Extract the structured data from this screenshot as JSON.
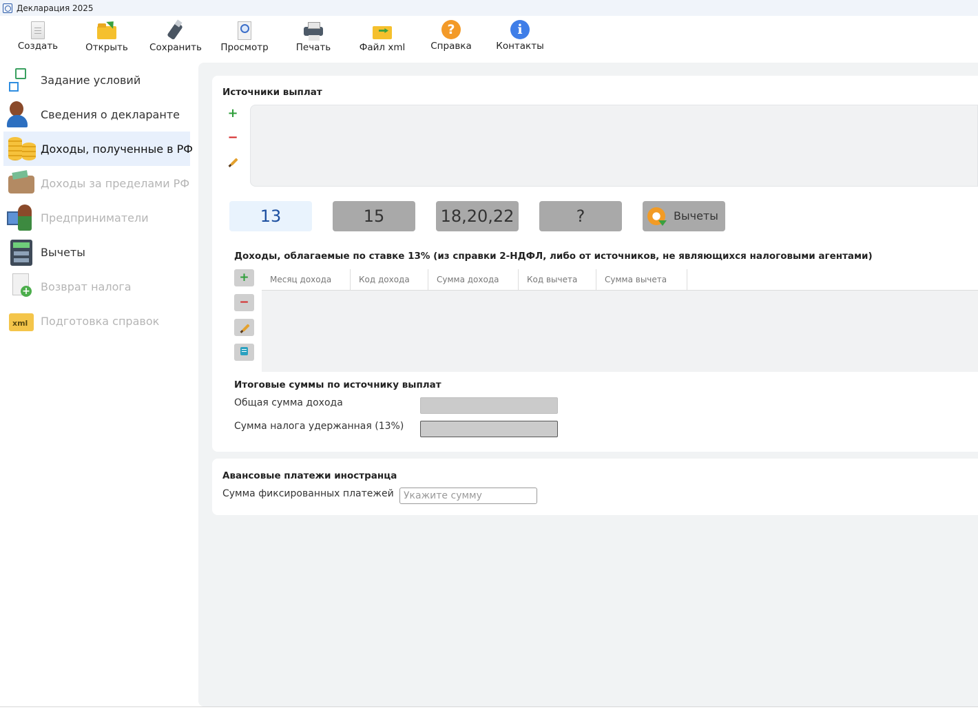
{
  "window": {
    "title": "Декларация 2025"
  },
  "toolbar": {
    "items": [
      {
        "label": "Создать",
        "icon": "new-document-icon"
      },
      {
        "label": "Открыть",
        "icon": "open-folder-icon"
      },
      {
        "label": "Сохранить",
        "icon": "usb-save-icon"
      },
      {
        "label": "Просмотр",
        "icon": "preview-icon"
      },
      {
        "label": "Печать",
        "icon": "printer-icon"
      },
      {
        "label": "Файл xml",
        "icon": "xml-folder-icon"
      },
      {
        "label": "Справка",
        "icon": "help-icon"
      },
      {
        "label": "Контакты",
        "icon": "info-icon"
      }
    ],
    "help_glyph": "?",
    "info_glyph": "i"
  },
  "sidebar": {
    "items": [
      {
        "label": "Задание условий",
        "icon": "conditions-icon",
        "state": "enabled"
      },
      {
        "label": "Сведения о декларанте",
        "icon": "declarant-icon",
        "state": "enabled"
      },
      {
        "label": "Доходы, полученные в РФ",
        "icon": "coins-icon",
        "state": "active"
      },
      {
        "label": "Доходы за пределами РФ",
        "icon": "wallet-icon",
        "state": "disabled"
      },
      {
        "label": "Предприниматели",
        "icon": "entrepreneur-icon",
        "state": "disabled"
      },
      {
        "label": "Вычеты",
        "icon": "calculator-icon",
        "state": "enabled"
      },
      {
        "label": "Возврат налога",
        "icon": "tax-refund-icon",
        "state": "disabled"
      },
      {
        "label": "Подготовка справок",
        "icon": "xml-folder-icon",
        "state": "disabled"
      }
    ]
  },
  "sources": {
    "title": "Источники выплат",
    "add_glyph": "+",
    "remove_glyph": "−"
  },
  "rates": {
    "tabs": [
      {
        "label": "13",
        "active": true
      },
      {
        "label": "15",
        "active": false
      },
      {
        "label": "18,20,22",
        "active": false
      },
      {
        "label": "?",
        "active": false
      }
    ],
    "deductions_label": "Вычеты"
  },
  "income": {
    "title": "Доходы, облагаемые по ставке 13% (из справки 2-НДФЛ, либо от источников, не являющихся налоговыми агентами)",
    "add_glyph": "+",
    "remove_glyph": "−",
    "columns": [
      "Месяц дохода",
      "Код дохода",
      "Сумма дохода",
      "Код вычета",
      "Сумма вычета"
    ],
    "rows": []
  },
  "totals": {
    "title": "Итоговые суммы по источнику выплат",
    "total_income_label": "Общая сумма дохода",
    "total_income_value": "",
    "tax_withheld_label": "Сумма налога удержанная (13%)",
    "tax_withheld_value": ""
  },
  "advance": {
    "title": "Авансовые платежи иностранца",
    "fixed_payments_label": "Сумма фиксированных платежей",
    "fixed_payments_placeholder": "Укажите сумму",
    "fixed_payments_value": ""
  },
  "colors": {
    "active_tab_bg": "#e9f3fd",
    "active_tab_text": "#1c4fa0",
    "inactive_tab_bg": "#a9a9a9",
    "sidebar_active_bg": "#e8f0fc",
    "main_bg": "#f1f3f4"
  }
}
